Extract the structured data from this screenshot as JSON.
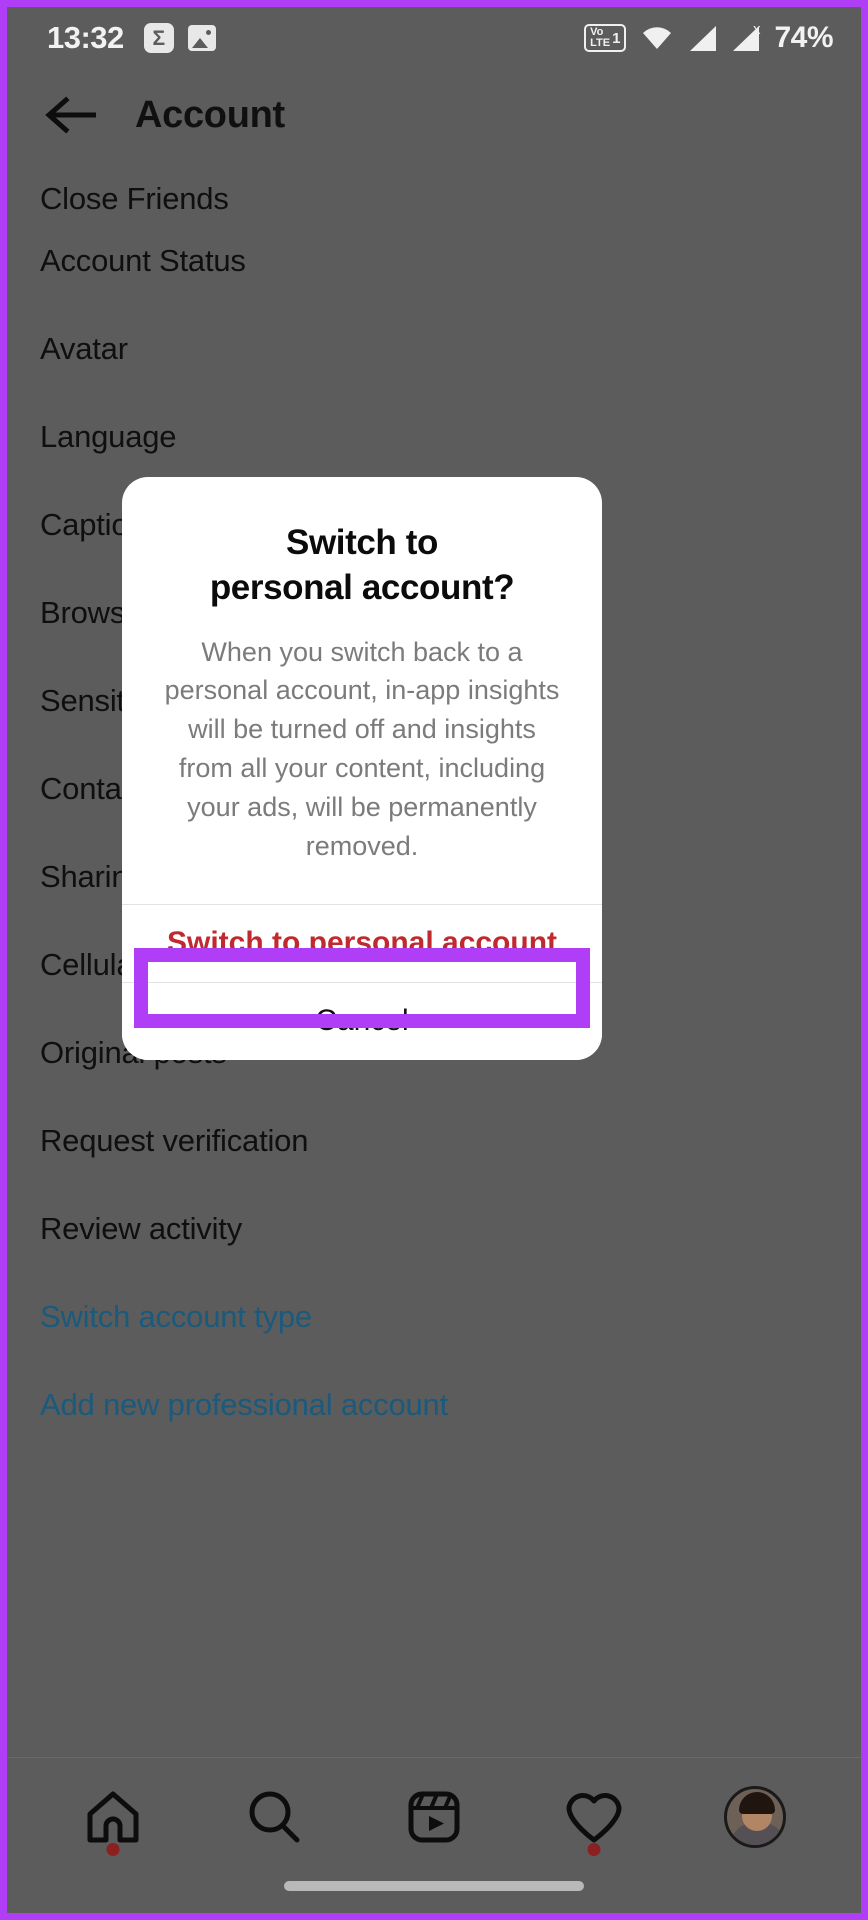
{
  "status_bar": {
    "time": "13:32",
    "sigma_icon_glyph": "Σ",
    "icons": [
      "sigma-icon",
      "photo-icon",
      "volte-icon",
      "wifi-icon",
      "signal-icon-1",
      "signal-icon-2"
    ],
    "volte_label_top": "Vo",
    "volte_label_bottom": "LTE",
    "volte_sim": "1",
    "signal_x_marker": "x",
    "battery": "74%"
  },
  "app_bar": {
    "back_icon": "back-arrow-icon",
    "title": "Account"
  },
  "settings_list": {
    "items": [
      {
        "label": "Close Friends",
        "type": "plain",
        "clipped": true
      },
      {
        "label": "Account Status",
        "type": "plain"
      },
      {
        "label": "Avatar",
        "type": "plain"
      },
      {
        "label": "Language",
        "type": "plain"
      },
      {
        "label": "Captions",
        "type": "plain"
      },
      {
        "label": "Browser",
        "type": "plain"
      },
      {
        "label": "Sensitive content control",
        "type": "plain"
      },
      {
        "label": "Contacts syncing",
        "type": "plain"
      },
      {
        "label": "Sharing to other apps",
        "type": "plain"
      },
      {
        "label": "Cellular data use",
        "type": "plain"
      },
      {
        "label": "Original posts",
        "type": "plain"
      },
      {
        "label": "Request verification",
        "type": "plain"
      },
      {
        "label": "Review activity",
        "type": "plain"
      },
      {
        "label": "Switch account type",
        "type": "link"
      },
      {
        "label": "Add new professional account",
        "type": "link"
      }
    ]
  },
  "dialog": {
    "title": "Switch to\npersonal account?",
    "title_line1": "Switch to",
    "title_line2": "personal account?",
    "body": "When you switch back to a personal account, in-app insights will be turned off and insights from all your content, including your ads, will be permanently removed.",
    "primary_button": "Switch to personal account",
    "secondary_button": "Cancel",
    "primary_button_color": "#c02a2f",
    "highlight_color": "#b13ef7"
  },
  "bottom_nav": {
    "items": [
      {
        "name": "home-icon",
        "badge": true
      },
      {
        "name": "search-icon",
        "badge": false
      },
      {
        "name": "reels-icon",
        "badge": false
      },
      {
        "name": "heart-icon",
        "badge": true
      },
      {
        "name": "profile-avatar",
        "badge": false
      }
    ]
  },
  "colors": {
    "dim_overlay": "#5c5c5c",
    "accent_highlight": "#b13ef7",
    "link_blue": "#1a5a7d",
    "destructive_red": "#c02a2f"
  }
}
